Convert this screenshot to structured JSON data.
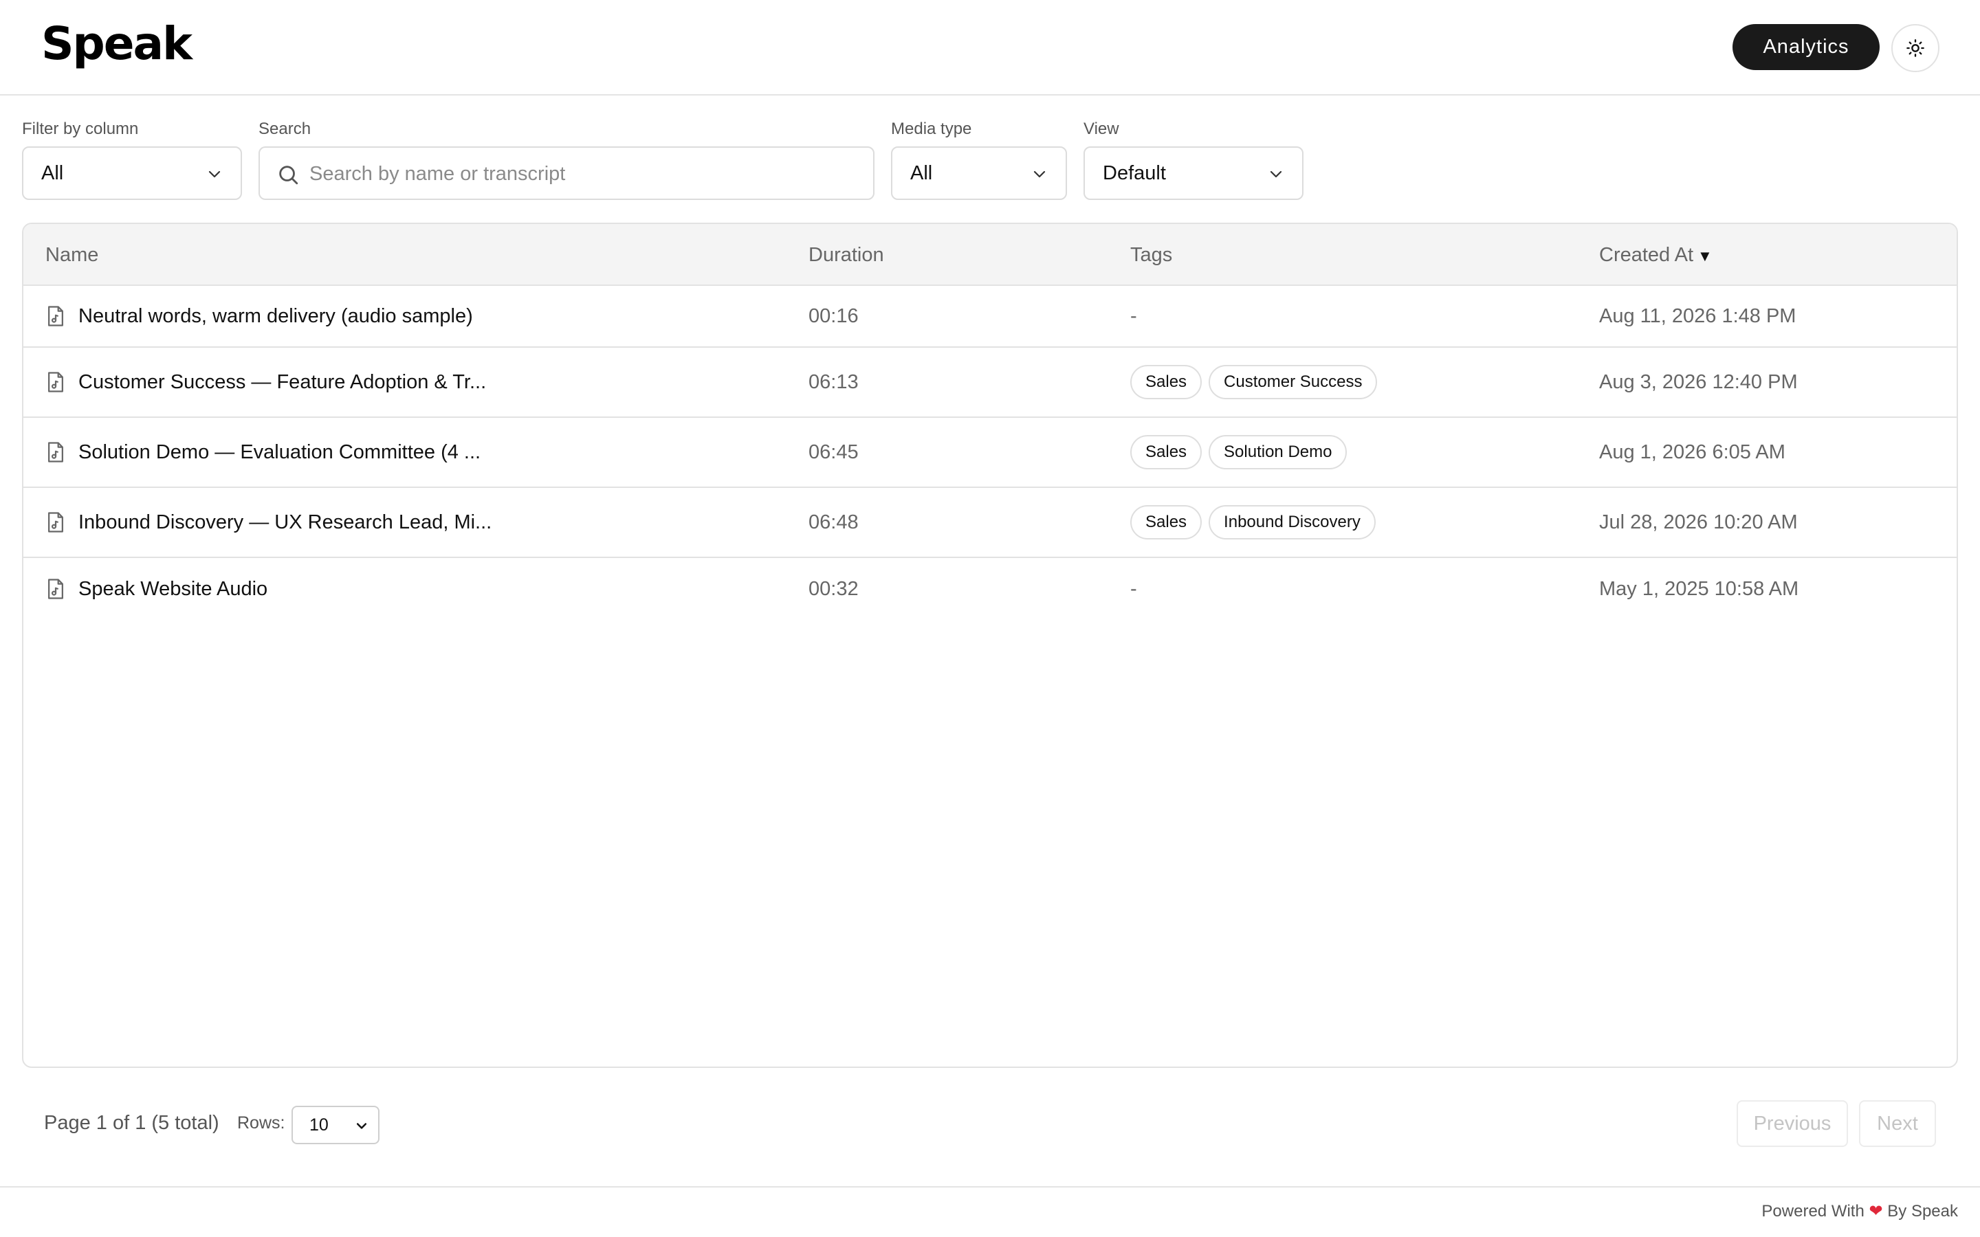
{
  "header": {
    "logo": "Speak",
    "analytics_label": "Analytics"
  },
  "filters": {
    "column": {
      "label": "Filter by column",
      "value": "All"
    },
    "search": {
      "label": "Search",
      "placeholder": "Search by name or transcript",
      "value": ""
    },
    "media_type": {
      "label": "Media type",
      "value": "All"
    },
    "view": {
      "label": "View",
      "value": "Default"
    }
  },
  "table": {
    "columns": {
      "name": "Name",
      "duration": "Duration",
      "tags": "Tags",
      "created_at": "Created At",
      "sort_indicator": "▼"
    },
    "rows": [
      {
        "name": "Neutral words, warm delivery (audio sample)",
        "duration": "00:16",
        "tags": [],
        "no_tags": "-",
        "created_at": "Aug 11, 2026 1:48 PM"
      },
      {
        "name": "Customer Success — Feature Adoption & Tr...",
        "duration": "06:13",
        "tags": [
          "Sales",
          "Customer Success"
        ],
        "created_at": "Aug 3, 2026 12:40 PM"
      },
      {
        "name": "Solution Demo — Evaluation Committee (4 ...",
        "duration": "06:45",
        "tags": [
          "Sales",
          "Solution Demo"
        ],
        "created_at": "Aug 1, 2026 6:05 AM"
      },
      {
        "name": "Inbound Discovery — UX Research Lead, Mi...",
        "duration": "06:48",
        "tags": [
          "Sales",
          "Inbound Discovery"
        ],
        "created_at": "Jul 28, 2026 10:20 AM"
      },
      {
        "name": "Speak Website Audio",
        "duration": "00:32",
        "tags": [],
        "no_tags": "-",
        "created_at": "May 1, 2025 10:58 AM"
      }
    ]
  },
  "pagination": {
    "page_info": "Page 1 of 1 (5 total)",
    "rows_label": "Rows:",
    "rows_value": "10",
    "previous_label": "Previous",
    "next_label": "Next"
  },
  "footer": {
    "powered_prefix": "Powered With",
    "heart": "❤",
    "powered_suffix": "By Speak"
  },
  "colors": {
    "accent_button": "#1a1a1a",
    "heart": "#e0283a"
  },
  "icons": {
    "theme": "sun-icon",
    "search": "search-icon",
    "select": "chevron-down-icon",
    "media_file": "audio-file-icon"
  }
}
